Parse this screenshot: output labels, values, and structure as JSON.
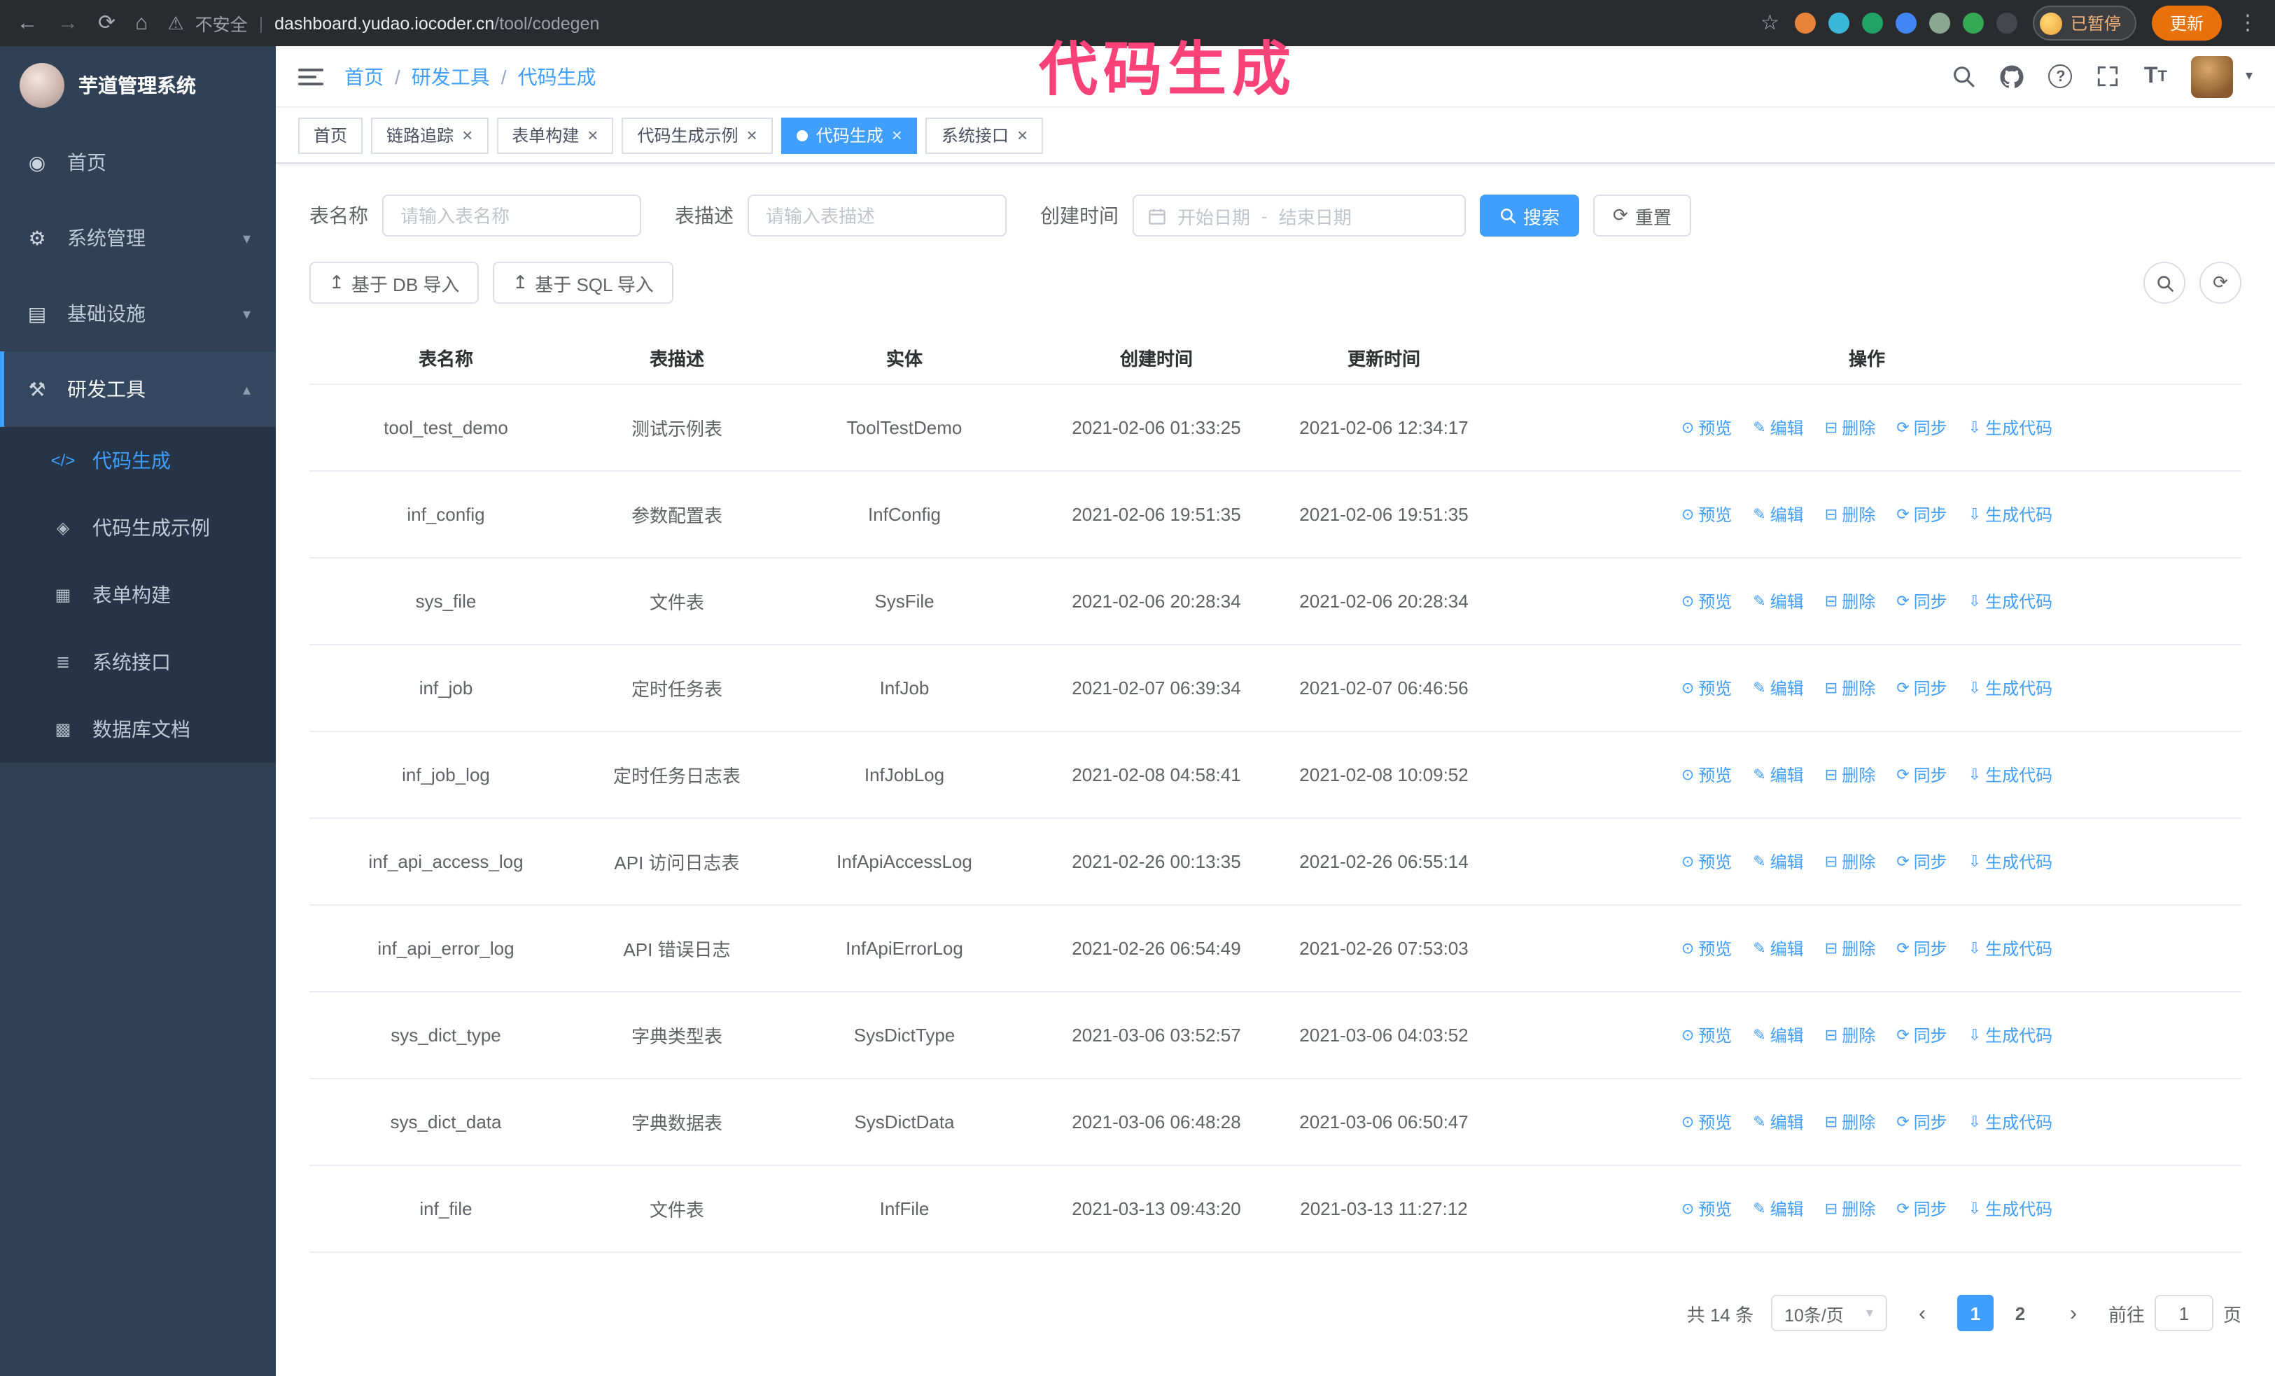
{
  "theme": {
    "accent": "#409eff",
    "sidebar_bg": "#304156",
    "submenu_bg": "#263445",
    "annotation_color": "#fb4278"
  },
  "browser": {
    "security_label": "不安全",
    "url_domain": "dashboard.yudao.iocoder.cn",
    "url_path": "/tool/codegen",
    "profile_badge": "已暂停",
    "update_button": "更新",
    "extension_colors": [
      "#e8833a",
      "#3ab6d8",
      "#21a366",
      "#4285f4",
      "#8aa891",
      "#34a853",
      "#44484d"
    ]
  },
  "annotation": {
    "text": "代码生成"
  },
  "sidebar": {
    "logo_title": "芋道管理系统",
    "items": [
      {
        "name": "home",
        "label": "首页",
        "icon": "dashboard-icon",
        "glyph": "◉"
      },
      {
        "name": "system",
        "label": "系统管理",
        "icon": "gear-icon",
        "glyph": "⚙",
        "chevron": "▾"
      },
      {
        "name": "infra",
        "label": "基础设施",
        "icon": "infrastructure-icon",
        "glyph": "▤",
        "chevron": "▾"
      },
      {
        "name": "devtools",
        "label": "研发工具",
        "icon": "tools-icon",
        "glyph": "⚒",
        "chevron": "▴",
        "active": true
      }
    ],
    "subitems": [
      {
        "name": "codegen",
        "label": "代码生成",
        "icon": "code-icon",
        "glyph": "</>",
        "active": true
      },
      {
        "name": "codegen-example",
        "label": "代码生成示例",
        "icon": "shield-icon",
        "glyph": "◈"
      },
      {
        "name": "form-builder",
        "label": "表单构建",
        "icon": "form-icon",
        "glyph": "▦"
      },
      {
        "name": "system-api",
        "label": "系统接口",
        "icon": "api-icon",
        "glyph": "≣"
      },
      {
        "name": "db-doc",
        "label": "数据库文档",
        "icon": "database-icon",
        "glyph": "▩"
      }
    ]
  },
  "navbar": {
    "breadcrumb": [
      "首页",
      "研发工具",
      "代码生成"
    ],
    "separator": "/"
  },
  "tabs": [
    {
      "name": "home",
      "label": "首页",
      "closable": false
    },
    {
      "name": "tracing",
      "label": "链路追踪",
      "closable": true
    },
    {
      "name": "form-builder",
      "label": "表单构建",
      "closable": true
    },
    {
      "name": "codegen-example",
      "label": "代码生成示例",
      "closable": true
    },
    {
      "name": "codegen",
      "label": "代码生成",
      "closable": true,
      "active": true
    },
    {
      "name": "system-api",
      "label": "系统接口",
      "closable": true
    }
  ],
  "filters": {
    "table_name_label": "表名称",
    "table_name_placeholder": "请输入表名称",
    "table_desc_label": "表描述",
    "table_desc_placeholder": "请输入表描述",
    "create_time_label": "创建时间",
    "date_start_placeholder": "开始日期",
    "date_separator": "-",
    "date_end_placeholder": "结束日期",
    "search_button": "搜索",
    "reset_button": "重置"
  },
  "toolbar": {
    "import_db": "基于 DB 导入",
    "import_sql": "基于 SQL 导入",
    "import_glyph": "↥"
  },
  "table": {
    "columns": [
      "表名称",
      "表描述",
      "实体",
      "创建时间",
      "更新时间",
      "操作"
    ],
    "actions": [
      {
        "name": "preview",
        "glyph": "⊙",
        "label": "预览"
      },
      {
        "name": "edit",
        "glyph": "✎",
        "label": "编辑"
      },
      {
        "name": "delete",
        "glyph": "⊟",
        "label": "删除"
      },
      {
        "name": "sync",
        "glyph": "⟳",
        "label": "同步"
      },
      {
        "name": "generate",
        "glyph": "⇩",
        "label": "生成代码"
      }
    ],
    "rows": [
      {
        "name": "tool_test_demo",
        "desc": "测试示例表",
        "entity": "ToolTestDemo",
        "created": "2021-02-06 01:33:25",
        "updated": "2021-02-06 12:34:17"
      },
      {
        "name": "inf_config",
        "desc": "参数配置表",
        "entity": "InfConfig",
        "created": "2021-02-06 19:51:35",
        "updated": "2021-02-06 19:51:35"
      },
      {
        "name": "sys_file",
        "desc": "文件表",
        "entity": "SysFile",
        "created": "2021-02-06 20:28:34",
        "updated": "2021-02-06 20:28:34"
      },
      {
        "name": "inf_job",
        "desc": "定时任务表",
        "entity": "InfJob",
        "created": "2021-02-07 06:39:34",
        "updated": "2021-02-07 06:46:56"
      },
      {
        "name": "inf_job_log",
        "desc": "定时任务日志表",
        "entity": "InfJobLog",
        "created": "2021-02-08 04:58:41",
        "updated": "2021-02-08 10:09:52"
      },
      {
        "name": "inf_api_access_log",
        "desc": "API 访问日志表",
        "entity": "InfApiAccessLog",
        "created": "2021-02-26 00:13:35",
        "updated": "2021-02-26 06:55:14"
      },
      {
        "name": "inf_api_error_log",
        "desc": "API 错误日志",
        "entity": "InfApiErrorLog",
        "created": "2021-02-26 06:54:49",
        "updated": "2021-02-26 07:53:03"
      },
      {
        "name": "sys_dict_type",
        "desc": "字典类型表",
        "entity": "SysDictType",
        "created": "2021-03-06 03:52:57",
        "updated": "2021-03-06 04:03:52"
      },
      {
        "name": "sys_dict_data",
        "desc": "字典数据表",
        "entity": "SysDictData",
        "created": "2021-03-06 06:48:28",
        "updated": "2021-03-06 06:50:47"
      },
      {
        "name": "inf_file",
        "desc": "文件表",
        "entity": "InfFile",
        "created": "2021-03-13 09:43:20",
        "updated": "2021-03-13 11:27:12"
      }
    ]
  },
  "pagination": {
    "total": "共 14 条",
    "page_size": "10条/页",
    "pages": [
      "1",
      "2"
    ],
    "active_page": "1",
    "goto_label": "前往",
    "goto_value": "1",
    "goto_suffix": "页"
  },
  "icons": {
    "back": "←",
    "forward": "→",
    "reload": "⟳",
    "home": "⌂",
    "warning": "⚠",
    "pipe": "|",
    "star": "☆",
    "kebab": "⋮",
    "close": "×",
    "question_mark": "?",
    "font_size": "T",
    "caret_down": "▾",
    "refresh": "⟳",
    "prev": "‹",
    "next": "›"
  }
}
